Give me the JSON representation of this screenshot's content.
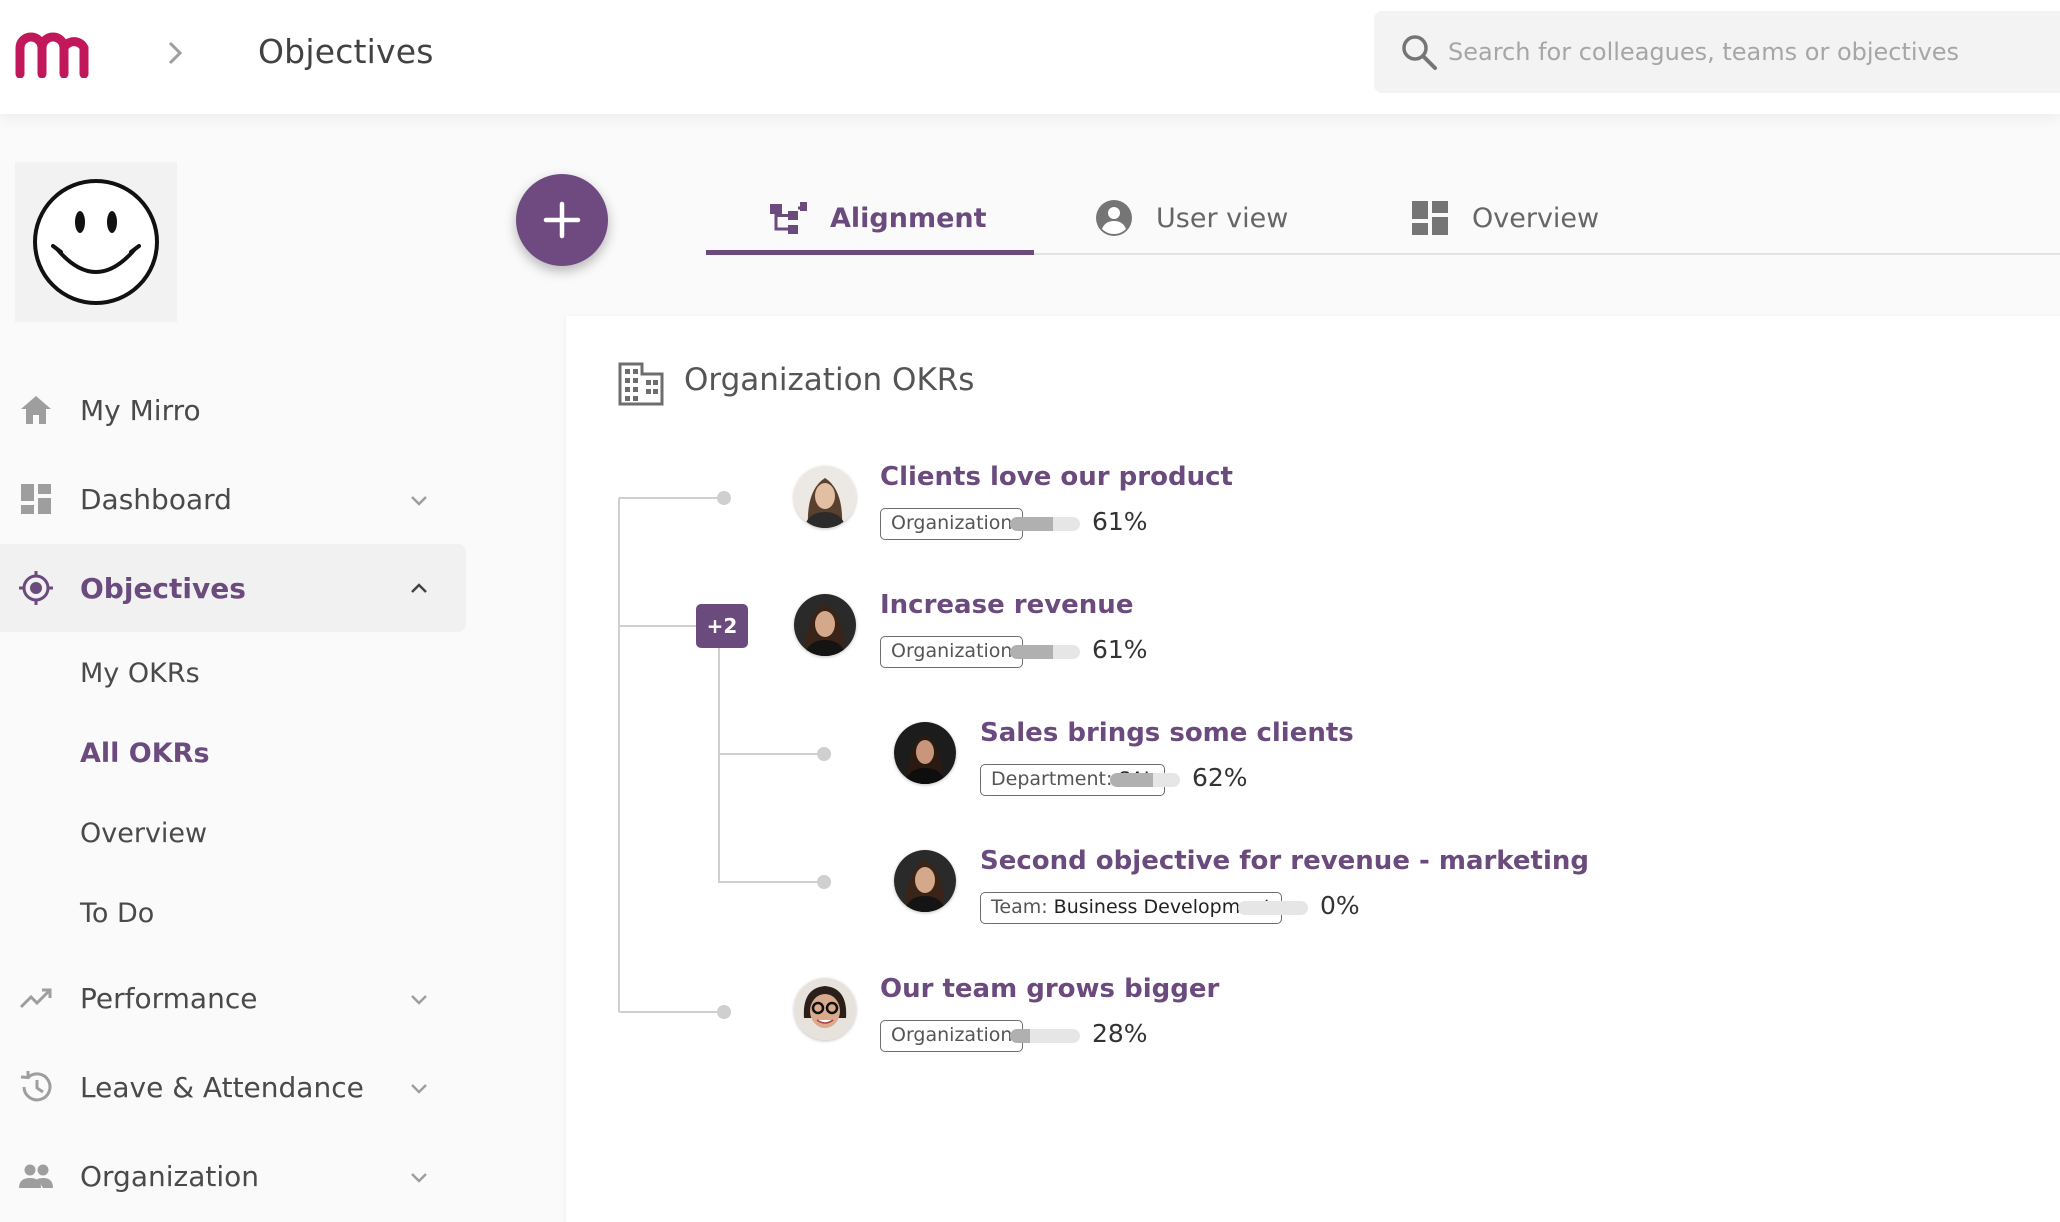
{
  "header": {
    "title": "Objectives",
    "search": {
      "placeholder": "Search for colleagues, teams or objectives",
      "value": ""
    }
  },
  "colors": {
    "accent": "#6b4a7e",
    "brand_logo": "#c2185b",
    "progress": "#b0b0b0"
  },
  "sidebar": {
    "items": [
      {
        "label": "My Mirro",
        "icon": "home-icon"
      },
      {
        "label": "Dashboard",
        "icon": "dashboard-icon"
      },
      {
        "label": "Objectives",
        "icon": "target-icon",
        "active": true,
        "sub_items": [
          {
            "label": "My OKRs"
          },
          {
            "label": "All OKRs",
            "active": true
          },
          {
            "label": "Overview"
          },
          {
            "label": "To Do"
          }
        ]
      },
      {
        "label": "Performance",
        "icon": "trending-up-icon"
      },
      {
        "label": "Leave & Attendance",
        "icon": "history-icon"
      },
      {
        "label": "Organization",
        "icon": "people-icon"
      }
    ]
  },
  "tabs": [
    {
      "label": "Alignment",
      "icon": "hierarchy-icon",
      "active": true
    },
    {
      "label": "User view",
      "icon": "user-circle-icon"
    },
    {
      "label": "Overview",
      "icon": "dashboard-icon"
    }
  ],
  "card": {
    "title": "Organization OKRs",
    "expand_badge": "+2",
    "objectives": [
      {
        "title": "Clients love our product",
        "tag": "Organization",
        "progress": 0.61,
        "progress_label": "61%"
      },
      {
        "title": "Increase revenue",
        "tag": "Organization",
        "progress": 0.61,
        "progress_label": "61%"
      },
      {
        "title": "Sales brings some clients",
        "tag_prefix": "Department:",
        "tag_value": "SAL",
        "progress": 0.62,
        "progress_label": "62%"
      },
      {
        "title": "Second objective for revenue - marketing",
        "tag_prefix": "Team:",
        "tag_value": "Business Development",
        "progress": 0.0,
        "progress_label": "0%"
      },
      {
        "title": "Our team grows bigger",
        "tag": "Organization",
        "progress": 0.28,
        "progress_label": "28%"
      }
    ]
  }
}
